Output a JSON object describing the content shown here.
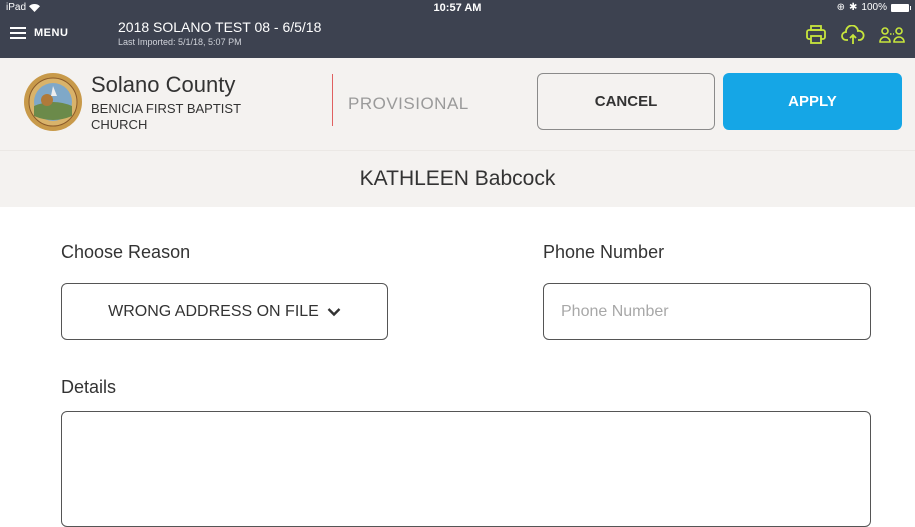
{
  "status_bar": {
    "device": "iPad",
    "time": "10:57 AM",
    "battery": "100%"
  },
  "header": {
    "menu_label": "MENU",
    "election_title": "2018 SOLANO TEST 08 - 6/5/18",
    "last_imported": "Last Imported: 5/1/18, 5:07 PM",
    "icons": [
      "printer-icon",
      "cloud-upload-icon",
      "users-sync-icon"
    ],
    "icon_color": "#c8e63c",
    "background": "#3d4250"
  },
  "location": {
    "county": "Solano County",
    "precinct": "BENICIA FIRST BAPTIST CHURCH",
    "mode": "PROVISIONAL"
  },
  "actions": {
    "cancel_label": "CANCEL",
    "apply_label": "APPLY",
    "apply_color": "#15a6e6"
  },
  "voter": {
    "name": "KATHLEEN Babcock"
  },
  "form": {
    "reason_label": "Choose Reason",
    "reason_value": "WRONG ADDRESS ON FILE",
    "phone_label": "Phone Number",
    "phone_placeholder": "Phone Number",
    "phone_value": "",
    "details_label": "Details",
    "details_value": ""
  }
}
